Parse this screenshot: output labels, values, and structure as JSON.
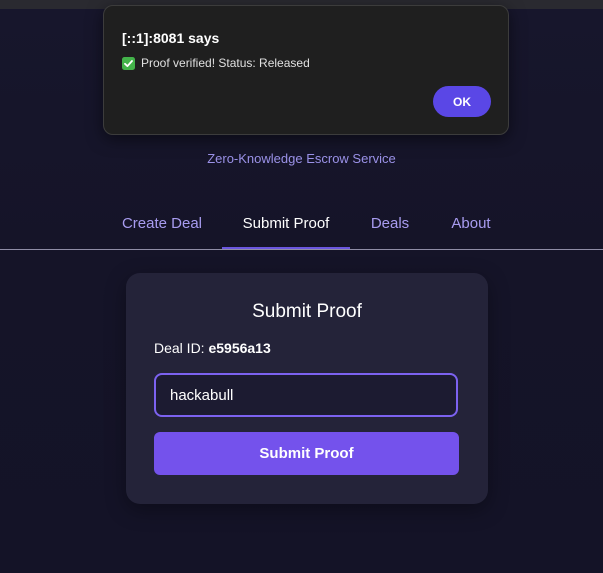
{
  "dialog": {
    "title": "[::1]:8081 says",
    "message": "Proof verified! Status: Released",
    "message_icon": "check-mark-button-icon",
    "ok_label": "OK"
  },
  "header": {
    "tagline": "Zero-Knowledge Escrow Service"
  },
  "nav": {
    "tabs": [
      {
        "label": "Create Deal",
        "active": false
      },
      {
        "label": "Submit Proof",
        "active": true
      },
      {
        "label": "Deals",
        "active": false
      },
      {
        "label": "About",
        "active": false
      }
    ]
  },
  "form": {
    "title": "Submit Proof",
    "deal_id_label": "Deal ID:",
    "deal_id_value": "e5956a13",
    "proof_input_value": "hackabull",
    "submit_label": "Submit Proof"
  },
  "colors": {
    "accent": "#7452ec",
    "tab_text": "#a89cf0",
    "background": "#151428"
  }
}
